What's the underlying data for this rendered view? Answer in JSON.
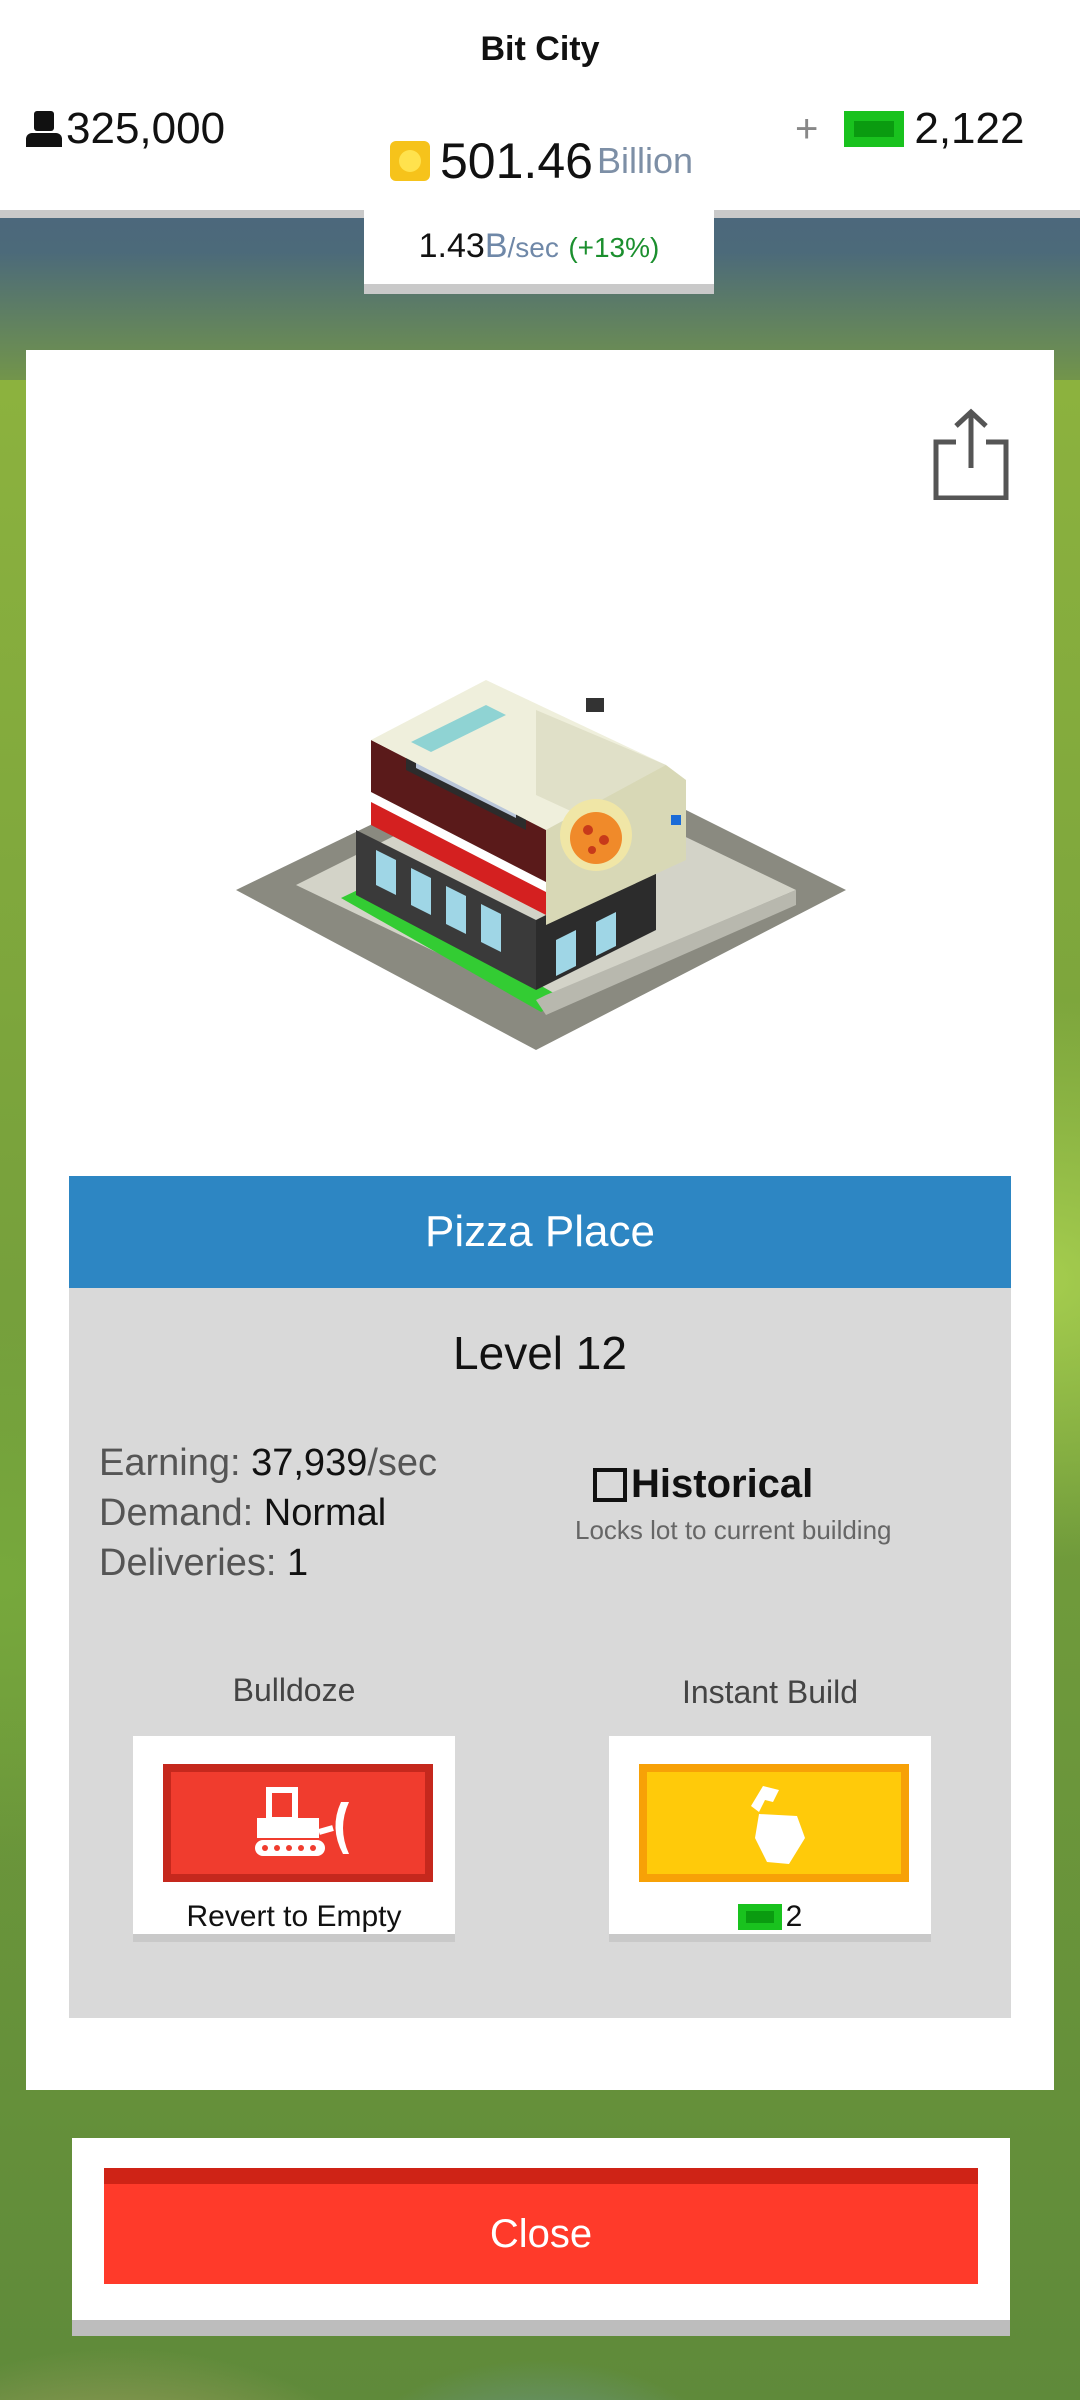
{
  "hud": {
    "title": "Bit City",
    "population": "325,000",
    "coins": {
      "amount": "501.46",
      "unit": "Billion"
    },
    "cash": {
      "plus": "+",
      "amount": "2,122"
    },
    "rate": {
      "value": "1.43",
      "suffix": "B",
      "per": "/sec",
      "change": "(+13%)"
    }
  },
  "building": {
    "name": "Pizza Place",
    "level": "Level 12",
    "stats": {
      "earning_label": "Earning:",
      "earning_value": "37,939",
      "earning_unit": "/sec",
      "demand_label": "Demand:",
      "demand_value": "Normal",
      "deliveries_label": "Deliveries:",
      "deliveries_value": "1"
    },
    "historical": {
      "label": "Historical",
      "checked": false,
      "description": "Locks lot to current building"
    }
  },
  "actions": {
    "bulldoze": {
      "label": "Bulldoze",
      "caption": "Revert to Empty",
      "icon": "bulldozer-icon"
    },
    "instant_build": {
      "label": "Instant Build",
      "cost": "2",
      "icon": "hammer-hand-icon"
    }
  },
  "close_label": "Close",
  "icons": {
    "population": "person-icon",
    "coins": "coin-icon",
    "cash": "cash-bill-icon",
    "share": "share-icon"
  },
  "colors": {
    "header_blue": "#2d86c3",
    "close_red": "#ff3a2a",
    "bulldoze_red": "#f03c2e",
    "build_yellow": "#ffca0a",
    "cash_green": "#19c21e",
    "coin_gold": "#f6c31b"
  }
}
